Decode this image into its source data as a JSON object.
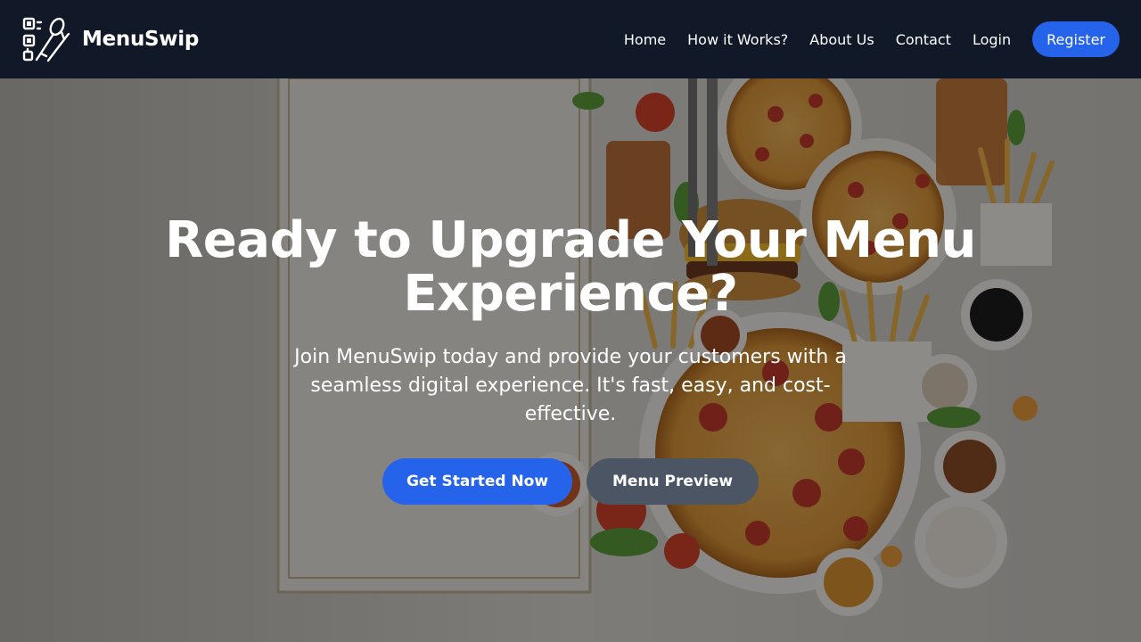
{
  "brand": {
    "name": "MenuSwip",
    "logo_icon": "qr-fork-spoon-icon"
  },
  "nav": {
    "links": [
      "Home",
      "How it Works?",
      "About Us",
      "Contact",
      "Login"
    ],
    "register_label": "Register"
  },
  "hero": {
    "title": "Ready to Upgrade Your Menu Experience?",
    "subtitle": "Join MenuSwip today and provide your customers with a seamless digital experience. It's fast, easy, and cost-effective.",
    "primary_button": "Get Started Now",
    "secondary_button": "Menu Preview",
    "background_image": "food-table-with-pizza-burgers-fries-and-menu-board"
  },
  "colors": {
    "navbar_bg": "#111827",
    "accent": "#2563eb",
    "secondary_button": "#4b5563",
    "text": "#ffffff"
  }
}
